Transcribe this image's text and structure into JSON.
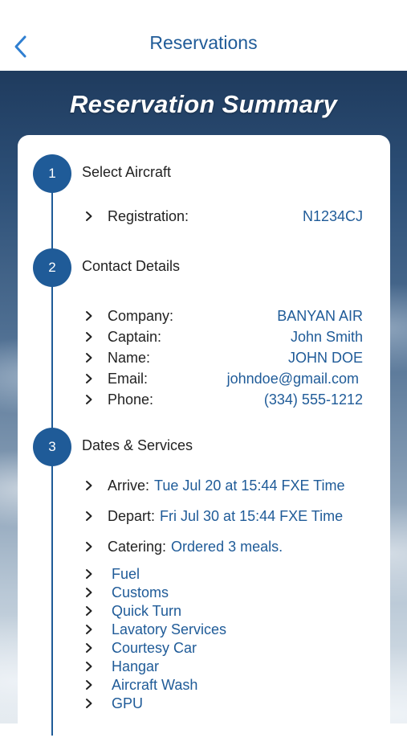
{
  "nav": {
    "title": "Reservations"
  },
  "hero": {
    "title": "Reservation Summary"
  },
  "colors": {
    "accent": "#1f5b98",
    "text": "#222222",
    "card": "#ffffff"
  },
  "steps": [
    {
      "number": "1",
      "title": "Select Aircraft",
      "rows": [
        {
          "label": "Registration:",
          "value": "N1234CJ"
        }
      ]
    },
    {
      "number": "2",
      "title": "Contact Details",
      "rows": [
        {
          "label": "Company:",
          "value": "BANYAN AIR"
        },
        {
          "label": "Captain:",
          "value": "John Smith"
        },
        {
          "label": "Name:",
          "value": "JOHN DOE"
        },
        {
          "label": "Email:",
          "value": "johndoe@gmail.com"
        },
        {
          "label": "Phone:",
          "value": "(334) 555-1212"
        }
      ]
    },
    {
      "number": "3",
      "title": "Dates & Services",
      "rows": [
        {
          "label": "Arrive:",
          "value": "Tue Jul 20 at 15:44 FXE Time"
        },
        {
          "label": "Depart:",
          "value": "Fri Jul 30 at 15:44 FXE Time"
        },
        {
          "label": "Catering:",
          "value": "Ordered 3 meals."
        }
      ],
      "services": [
        "Fuel",
        "Customs",
        "Quick Turn",
        "Lavatory Services",
        "Courtesy Car",
        "Hangar",
        "Aircraft Wash",
        "GPU"
      ]
    }
  ],
  "icons": {
    "back": "chevron-left-icon",
    "row": "chevron-right-icon"
  }
}
